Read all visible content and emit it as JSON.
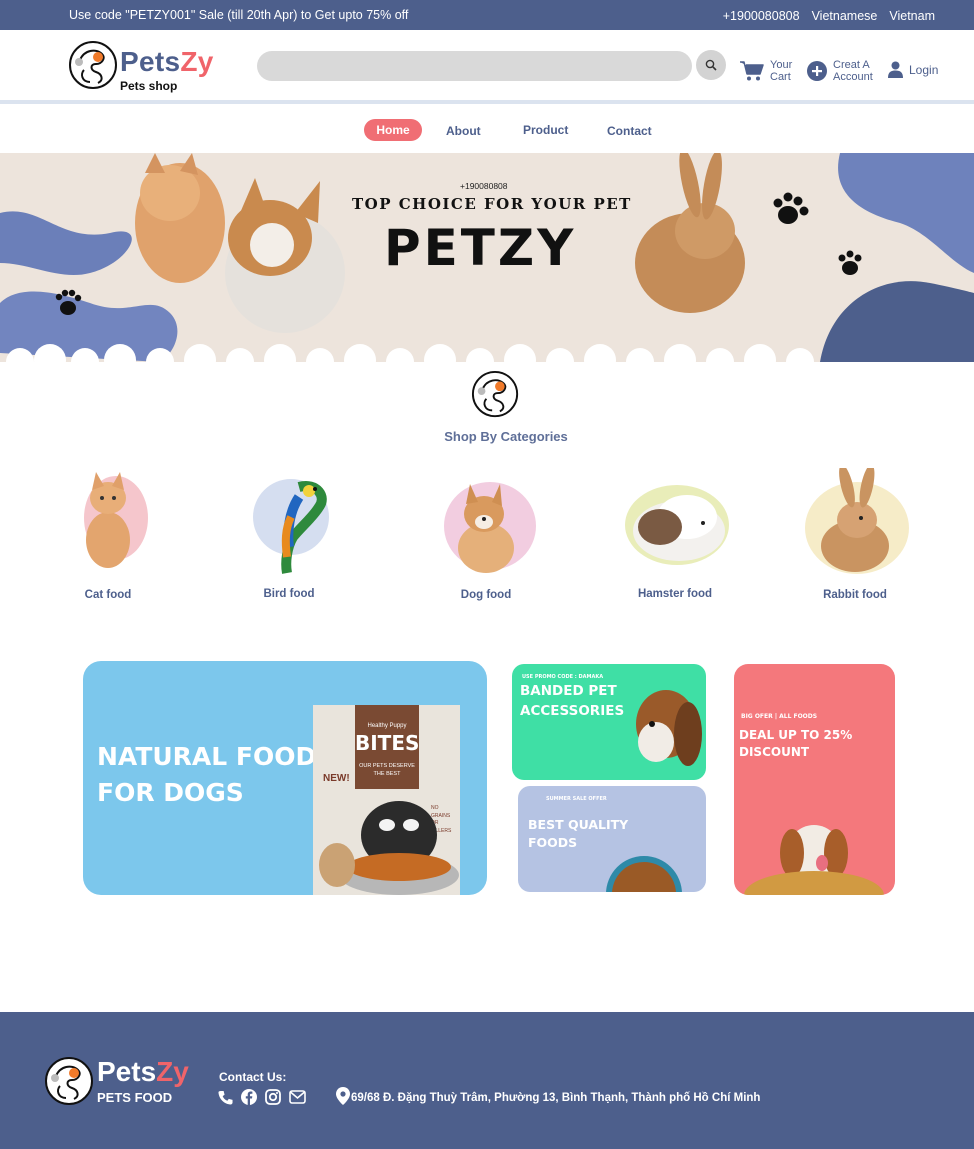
{
  "topbar": {
    "promo_text": "Use code \"PETZY001\" Sale (till 20th Apr) to Get upto 75% off",
    "phone": "+1900080808",
    "language": "Vietnamese",
    "country": "Vietnam"
  },
  "header": {
    "brand_pets": "Pets",
    "brand_zy": "Zy",
    "brand_sub": "Pets shop",
    "search_placeholder": "",
    "cart_line1": "Your",
    "cart_line2": "Cart",
    "account_line1": "Creat A",
    "account_line2": "Account",
    "login_label": "Login"
  },
  "nav": {
    "items": [
      {
        "label": "Home"
      },
      {
        "label": "About"
      },
      {
        "label": "Product"
      },
      {
        "label": "Contact"
      }
    ]
  },
  "hero": {
    "phone": "+190080808",
    "tagline": "TOP CHOICE FOR YOUR PET",
    "title": "PETZY"
  },
  "categories": {
    "title": "Shop By Categories",
    "items": [
      {
        "label": "Cat food"
      },
      {
        "label": "Bird food"
      },
      {
        "label": "Dog food"
      },
      {
        "label": "Hamster food"
      },
      {
        "label": "Rabbit food"
      }
    ]
  },
  "promos": {
    "natural": {
      "line1": "NATURAL FOOD",
      "line2": "FOR DOGS",
      "pack_small": "Healthy Puppy",
      "pack_title": "BITES",
      "pack_sub": "OUR PETS DESERVE THE BEST",
      "new_tag": "NEW!",
      "pack_side": "NO GRAINS OR FILLERS"
    },
    "banded": {
      "tag": "USE PROMO CODE : DAMAKA",
      "line1": "BANDED PET",
      "line2": "ACCESSORIES"
    },
    "quality": {
      "tag": "SUMMER SALE OFFER",
      "line1": "BEST QUALITY",
      "line2": "FOODS"
    },
    "deal": {
      "tag": "BIG OFER | ALL FOODS",
      "line1": "DEAL UP TO 25%",
      "line2": "DISCOUNT"
    }
  },
  "footer": {
    "brand_pets": "Pets",
    "brand_zy": "Zy",
    "brand_sub": "PETS FOOD",
    "contact_title": "Contact Us:",
    "address": "69/68 Đ. Đặng Thuỳ Trâm, Phường 13, Bình Thạnh, Thành phố Hồ Chí Minh"
  },
  "colors": {
    "primary": "#4d5f8c",
    "accent": "#f0646a",
    "hero_bg": "#ede4dc",
    "promo_blue": "#7cc7ec",
    "promo_green": "#3fdfa5",
    "promo_lavender": "#b5c3e3",
    "promo_pink": "#f4787c"
  }
}
